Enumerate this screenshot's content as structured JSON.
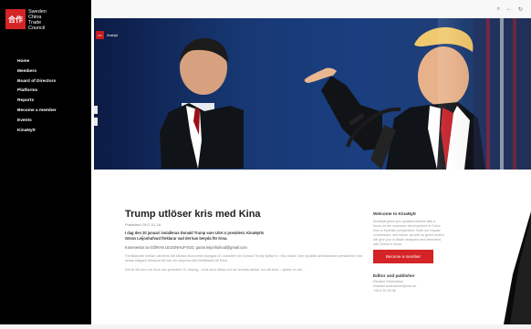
{
  "sidebar": {
    "logo_mark": "合作",
    "logo_text": [
      "Sweden",
      "China",
      "Trade",
      "Council"
    ],
    "nav": [
      "Home",
      "Members",
      "Board of Directors",
      "Platforms",
      "Reports",
      "Become a member",
      "Events",
      "KinaNytt"
    ]
  },
  "top": {
    "icons": [
      "paperclip-icon",
      "arrow-left-icon",
      "refresh-icon"
    ]
  },
  "hero": {
    "brand_mark": "KN",
    "brand_name": "KinaNytt"
  },
  "article": {
    "title": "Trump utlöser kris med Kina",
    "published": "Published 2017-01-19",
    "lead": "I dag den 20 januari installeras Donald Trump som USA:s president. KinaNytts Göran Leijonhufvud förklarar vad det kan betyda för Kina.",
    "comment": "Kommentar av GÖRAN LEIJONHUFVUD, goran.leijonhufvud@gmail.com",
    "para1": "Förhållandet mellan världens två största ekonomier slungas ut i ovisshet när Donald Trump flyttar in i Vita huset. Den nyvalde amerikanske presidenten har sedan tidigare förklarat att han vill ompröva sitt förhållande till Kina.",
    "para2": "Det är så som om Kina och president Xi Jinping – trots sina hårda ord om andras tankar om sitt land – spelar en roll..."
  },
  "aside": {
    "heading": "Welcome to KinaNytt",
    "body": "KinaNytt gives you updated articles with a focus on the economic development in China from a Swedish perspective. Both our regular contributors, see below, as well as guest writers will give you in-depth analyses and interviews with China in focus.",
    "button": "Become a member",
    "editor_heading": "Editor and publisher",
    "editor_lines": [
      "Elisabet Söderström",
      "elisabet.soderstrom@sctc.se",
      "+46 8 22 05 06"
    ]
  }
}
